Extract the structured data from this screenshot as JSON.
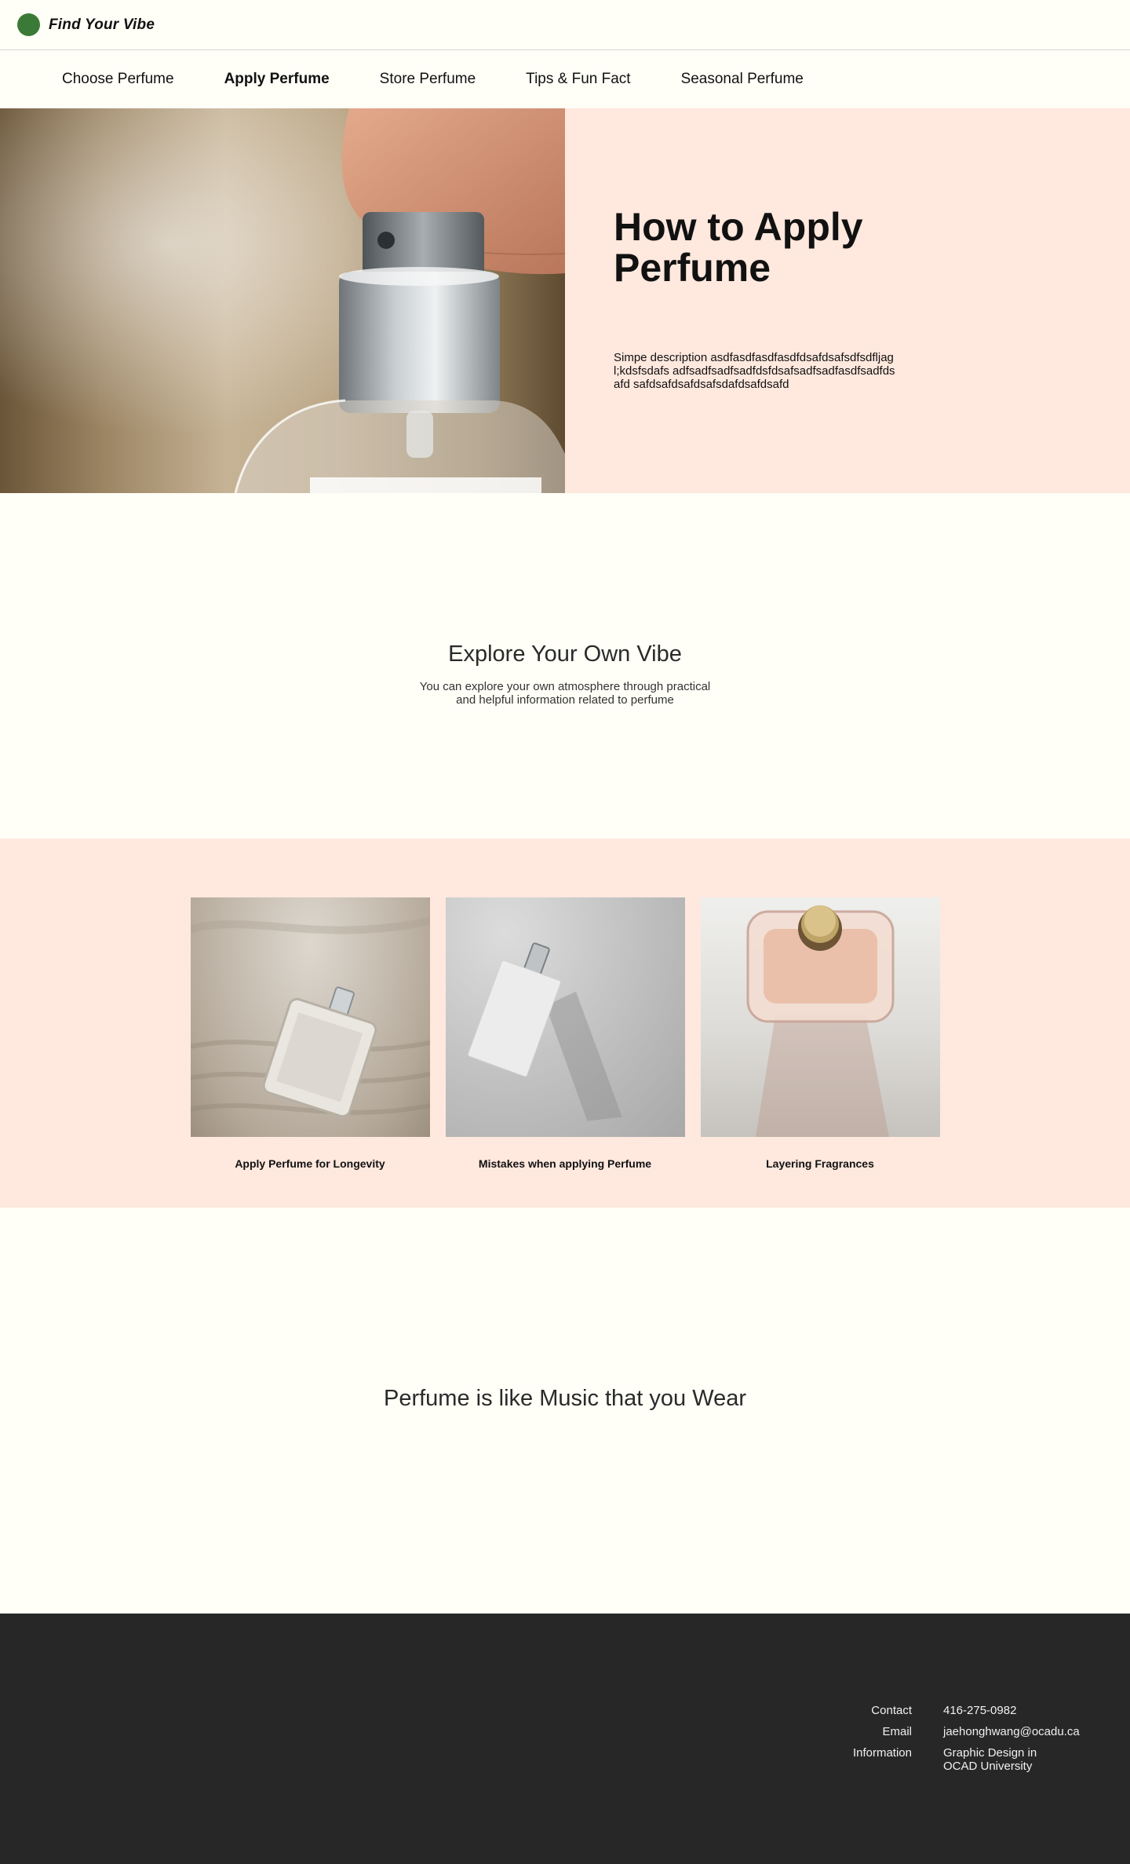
{
  "header": {
    "brand": "Find Your Vibe",
    "logo_color": "#3b7a36"
  },
  "nav": {
    "items": [
      {
        "label": "Choose Perfume",
        "active": false
      },
      {
        "label": "Apply Perfume",
        "active": true
      },
      {
        "label": "Store Perfume",
        "active": false
      },
      {
        "label": "Tips & Fun Fact",
        "active": false
      },
      {
        "label": "Seasonal Perfume",
        "active": false
      }
    ]
  },
  "hero": {
    "title": "How to Apply Perfume",
    "description": "Simpe description asdfasdfasdfasdfdsafdsafsdfsdfljagl;kdsfsdafs adfsadfsadfsadfdsfdsafsadfsadfasdfsadfdsafd safdsafdsafdsafsdafdsafdsafd",
    "image": "perfume-spray-photo"
  },
  "explore": {
    "title": "Explore Your Own Vibe",
    "subtitle": "You can explore your own atmosphere through practical and helpful information related to perfume"
  },
  "cards": [
    {
      "label": "Apply Perfume for Longevity",
      "image": "perfume-bottle-in-sand-photo"
    },
    {
      "label": "Mistakes when applying Perfume",
      "image": "white-perfume-bottle-photo"
    },
    {
      "label": "Layering Fragrances",
      "image": "glass-perfume-bottle-photo"
    }
  ],
  "quote": {
    "text": "Perfume is like Music that you Wear"
  },
  "footer": {
    "contact_label": "Contact",
    "contact_value": "416-275-0982",
    "email_label": "Email",
    "email_value": "jaehonghwang@ocadu.ca",
    "info_label": "Information",
    "info_value_line1": "Graphic Design in",
    "info_value_line2": "OCAD University"
  },
  "colors": {
    "page_bg": "#fffef7",
    "accent_bg": "#ffe8de",
    "footer_bg": "#272727"
  }
}
